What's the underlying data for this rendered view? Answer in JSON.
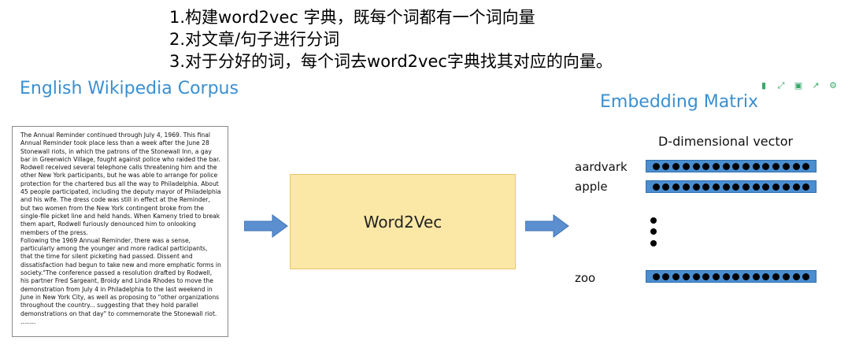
{
  "steps": [
    "1.构建word2vec 字典，既每个词都有一个词向量",
    "2.对文章/句子进行分词",
    "3.对于分好的词，每个词去word2vec字典找其对应的向量。"
  ],
  "corpus": {
    "title": "English Wikipedia Corpus",
    "paragraph1": "The Annual Reminder continued through July 4, 1969. This final Annual Reminder took place less than a week after the June 28 Stonewall riots, in which the patrons of the Stonewall Inn, a gay bar in Greenwich Village, fought against police who raided the bar. Rodwell received several telephone calls threatening him and the other New York participants, but he was able to arrange for police protection for the chartered bus all the way to Philadelphia. About 45 people participated, including the deputy mayor of Philadelphia and his wife. The dress code was still in effect at the Reminder, but two women from the New York contingent broke from the single-file picket line and held hands. When Kameny tried to break them apart, Rodwell furiously denounced him to onlooking members of the press.",
    "paragraph2": "Following the 1969 Annual Reminder, there was a sense, particularly among the younger and more radical participants, that the time for silent picketing had passed. Dissent and dissatisfaction had begun to take new and more emphatic forms in society.\"The conference passed a resolution drafted by Rodwell, his partner Fred Sargeant, Broidy and Linda Rhodes to move the demonstration from July 4 in Philadelphia to the last weekend in June in New York City, as well as proposing to \"other organizations throughout the country... suggesting that they hold parallel demonstrations on that day\" to commemorate the Stonewall riot.  ........"
  },
  "model": {
    "label": "Word2Vec"
  },
  "embedding": {
    "title": "Embedding Matrix",
    "dim_label": "D-dimensional vector",
    "words": [
      "aardvark",
      "apple",
      "zoo"
    ],
    "dots_per_vector": 16,
    "vector_color": "#4a8ed0"
  },
  "toolbar": {
    "icons": [
      "bookmark-icon",
      "expand-icon",
      "save-icon",
      "share-icon",
      "settings-icon"
    ],
    "color": "#3aa86b"
  }
}
